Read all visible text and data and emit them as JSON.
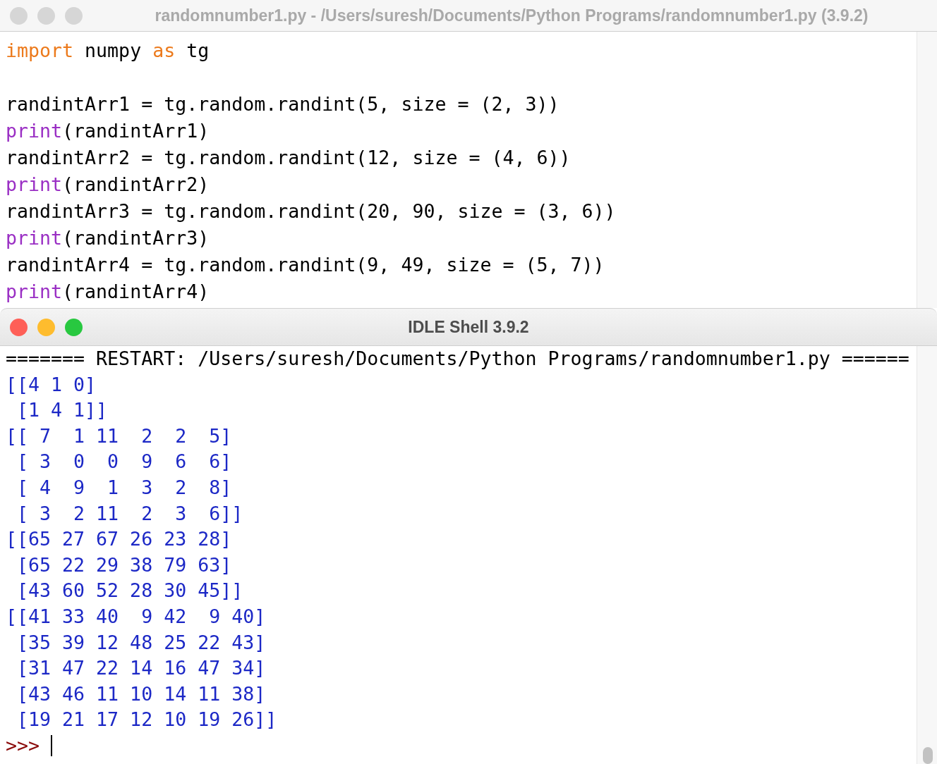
{
  "editor": {
    "window": {
      "title": "randomnumber1.py - /Users/suresh/Documents/Python Programs/randomnumber1.py (3.9.2)",
      "active": false
    },
    "lines": [
      {
        "kind": "code",
        "tokens": [
          {
            "kind": "keyword",
            "text": "import"
          },
          {
            "kind": "plain",
            "text": " numpy "
          },
          {
            "kind": "keyword",
            "text": "as"
          },
          {
            "kind": "plain",
            "text": " tg"
          }
        ]
      },
      {
        "kind": "blank"
      },
      {
        "kind": "code",
        "tokens": [
          {
            "kind": "plain",
            "text": "randintArr1 = tg.random.randint(5, size = (2, 3))"
          }
        ]
      },
      {
        "kind": "code",
        "tokens": [
          {
            "kind": "builtin",
            "text": "print"
          },
          {
            "kind": "plain",
            "text": "(randintArr1)"
          }
        ]
      },
      {
        "kind": "code",
        "tokens": [
          {
            "kind": "plain",
            "text": "randintArr2 = tg.random.randint(12, size = (4, 6))"
          }
        ]
      },
      {
        "kind": "code",
        "tokens": [
          {
            "kind": "builtin",
            "text": "print"
          },
          {
            "kind": "plain",
            "text": "(randintArr2)"
          }
        ]
      },
      {
        "kind": "code",
        "tokens": [
          {
            "kind": "plain",
            "text": "randintArr3 = tg.random.randint(20, 90, size = (3, 6))"
          }
        ]
      },
      {
        "kind": "code",
        "tokens": [
          {
            "kind": "builtin",
            "text": "print"
          },
          {
            "kind": "plain",
            "text": "(randintArr3)"
          }
        ]
      },
      {
        "kind": "code",
        "tokens": [
          {
            "kind": "plain",
            "text": "randintArr4 = tg.random.randint(9, 49, size = (5, 7))"
          }
        ]
      },
      {
        "kind": "code",
        "tokens": [
          {
            "kind": "builtin",
            "text": "print"
          },
          {
            "kind": "plain",
            "text": "(randintArr4)"
          }
        ]
      }
    ]
  },
  "shell": {
    "window": {
      "title": "IDLE Shell 3.9.2",
      "active": true
    },
    "lines": [
      {
        "kind": "restart",
        "text": "======= RESTART: /Users/suresh/Documents/Python Programs/randomnumber1.py ======"
      },
      {
        "kind": "output",
        "text": "[[4 1 0]"
      },
      {
        "kind": "output",
        "text": " [1 4 1]]"
      },
      {
        "kind": "output",
        "text": "[[ 7  1 11  2  2  5]"
      },
      {
        "kind": "output",
        "text": " [ 3  0  0  9  6  6]"
      },
      {
        "kind": "output",
        "text": " [ 4  9  1  3  2  8]"
      },
      {
        "kind": "output",
        "text": " [ 3  2 11  2  3  6]]"
      },
      {
        "kind": "output",
        "text": "[[65 27 67 26 23 28]"
      },
      {
        "kind": "output",
        "text": " [65 22 29 38 79 63]"
      },
      {
        "kind": "output",
        "text": " [43 60 52 28 30 45]]"
      },
      {
        "kind": "output",
        "text": "[[41 33 40  9 42  9 40]"
      },
      {
        "kind": "output",
        "text": " [35 39 12 48 25 22 43]"
      },
      {
        "kind": "output",
        "text": " [31 47 22 14 16 47 34]"
      },
      {
        "kind": "output",
        "text": " [43 46 11 10 14 11 38]"
      },
      {
        "kind": "output",
        "text": " [19 21 17 12 10 19 26]]"
      }
    ],
    "prompt": ">>>"
  }
}
